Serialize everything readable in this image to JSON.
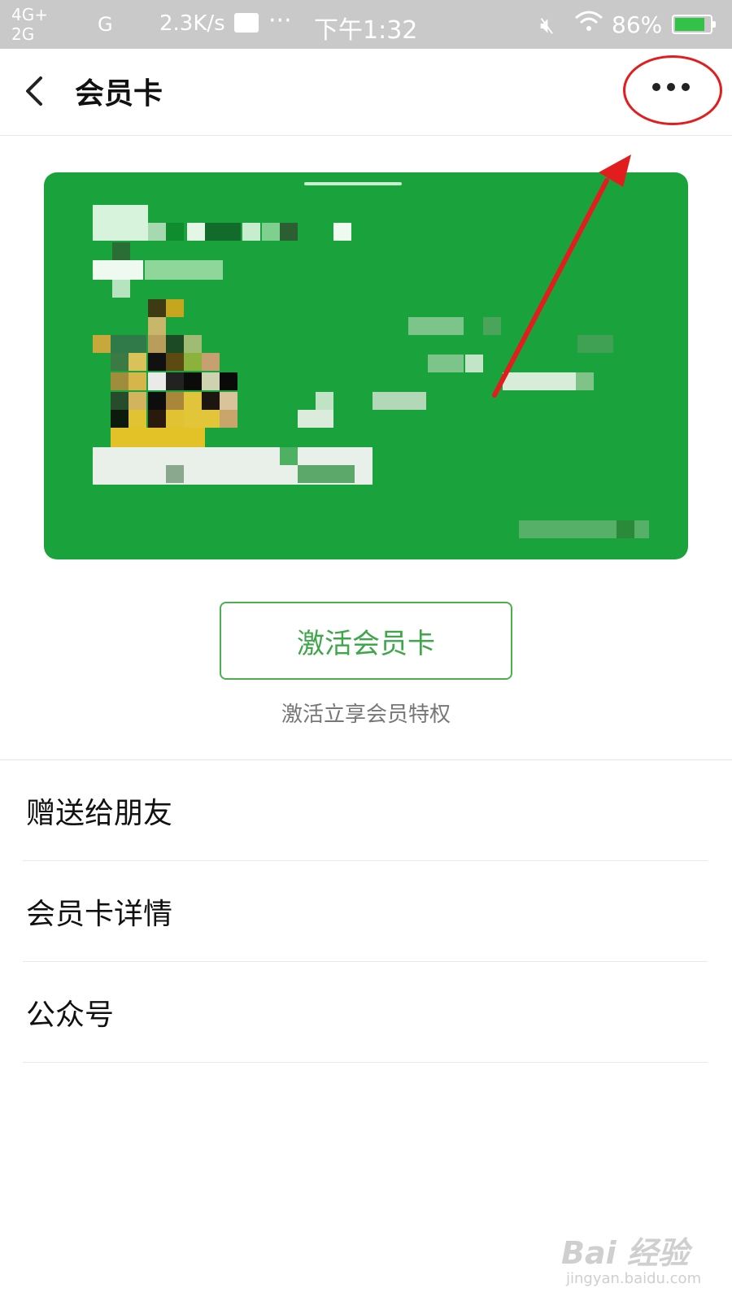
{
  "status_bar": {
    "network_top": "4G+",
    "network_bottom": "2G",
    "network_g": "G",
    "speed": "2.3K/s",
    "dots": "···",
    "time": "下午1:32",
    "battery_pct": "86%",
    "battery_level": 0.86
  },
  "nav": {
    "title": "会员卡"
  },
  "card": {
    "background_color": "#1aa33c"
  },
  "activate": {
    "button_label": "激活会员卡",
    "subtitle": "激活立享会员特权"
  },
  "menu": {
    "items": [
      {
        "label": "赠送给朋友"
      },
      {
        "label": "会员卡详情"
      },
      {
        "label": "公众号"
      }
    ]
  },
  "watermark": {
    "main": "Bai 经验",
    "sub": "jingyan.baidu.com"
  },
  "annotation": {
    "color": "#e21d1d"
  }
}
